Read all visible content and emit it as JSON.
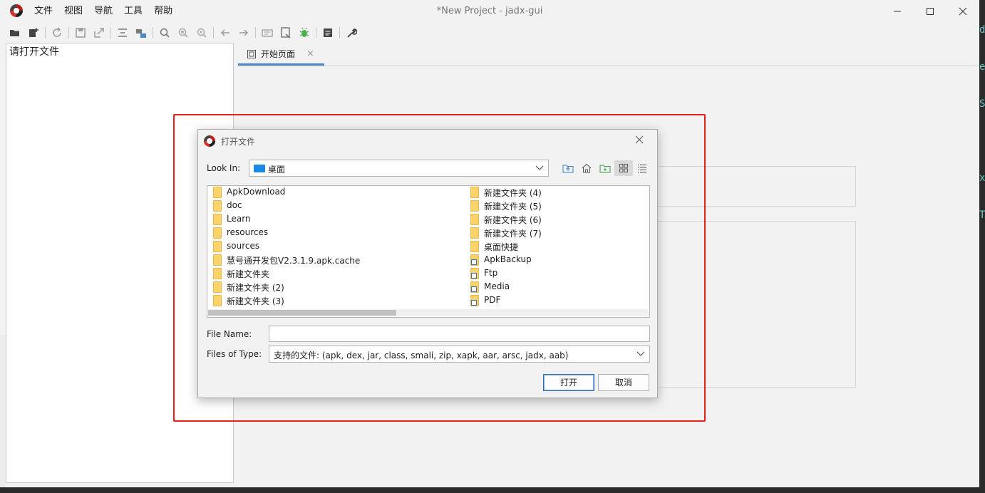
{
  "window": {
    "title": "*New Project - jadx-gui"
  },
  "menu": [
    {
      "label": "文件"
    },
    {
      "label": "视图"
    },
    {
      "label": "导航"
    },
    {
      "label": "工具"
    },
    {
      "label": "帮助"
    }
  ],
  "toolbar_icons": [
    "open-folder-icon",
    "add-files-icon",
    "sep",
    "sync-icon",
    "sep",
    "save-icon",
    "export-icon",
    "sep",
    "flatten-packages-icon",
    "package-tree-icon",
    "sep",
    "search-icon",
    "find-class-icon",
    "find-usage-icon",
    "sep",
    "back-arrow-icon",
    "forward-arrow-icon",
    "sep",
    "deobfuscate-icon",
    "quick-tab-icon",
    "debug-icon",
    "sep",
    "log-viewer-icon",
    "sep",
    "preferences-wrench-icon"
  ],
  "tree_panel": {
    "hint": "请打开文件"
  },
  "editor": {
    "tab_label": "开始页面",
    "tab_close": "×"
  },
  "right_strip_chars": [
    {
      "c": "d"
    },
    {
      "c": "e"
    },
    {
      "c": "S"
    },
    {
      "c": "x"
    },
    {
      "c": "T"
    }
  ],
  "dialog": {
    "title": "打开文件",
    "look_in_label": "Look In:",
    "look_in_value": "桌面",
    "file_name_label": "File Name:",
    "file_name_value": "",
    "files_of_type_label": "Files of Type:",
    "files_of_type_value": "支持的文件: (apk, dex, jar, class, smali, zip, xapk, aar, arsc, jadx, aab)",
    "open_button": "打开",
    "cancel_button": "取消",
    "files_left": [
      {
        "name": "ApkDownload",
        "shortcut": false
      },
      {
        "name": "doc",
        "shortcut": false
      },
      {
        "name": "Learn",
        "shortcut": false
      },
      {
        "name": "resources",
        "shortcut": false
      },
      {
        "name": "sources",
        "shortcut": false
      },
      {
        "name": "慧号通开发包V2.3.1.9.apk.cache",
        "shortcut": false
      },
      {
        "name": "新建文件夹",
        "shortcut": false
      },
      {
        "name": "新建文件夹 (2)",
        "shortcut": false
      },
      {
        "name": "新建文件夹 (3)",
        "shortcut": false
      }
    ],
    "files_right": [
      {
        "name": "新建文件夹 (4)",
        "shortcut": false
      },
      {
        "name": "新建文件夹 (5)",
        "shortcut": false
      },
      {
        "name": "新建文件夹 (6)",
        "shortcut": false
      },
      {
        "name": "新建文件夹 (7)",
        "shortcut": false
      },
      {
        "name": "桌面快捷",
        "shortcut": false
      },
      {
        "name": "ApkBackup",
        "shortcut": true
      },
      {
        "name": "Ftp",
        "shortcut": true
      },
      {
        "name": "Media",
        "shortcut": true
      },
      {
        "name": "PDF",
        "shortcut": true
      }
    ]
  },
  "colors": {
    "highlight": "#e8221b",
    "tab_accent": "#4a88c7",
    "folder": "#fbd36a"
  }
}
